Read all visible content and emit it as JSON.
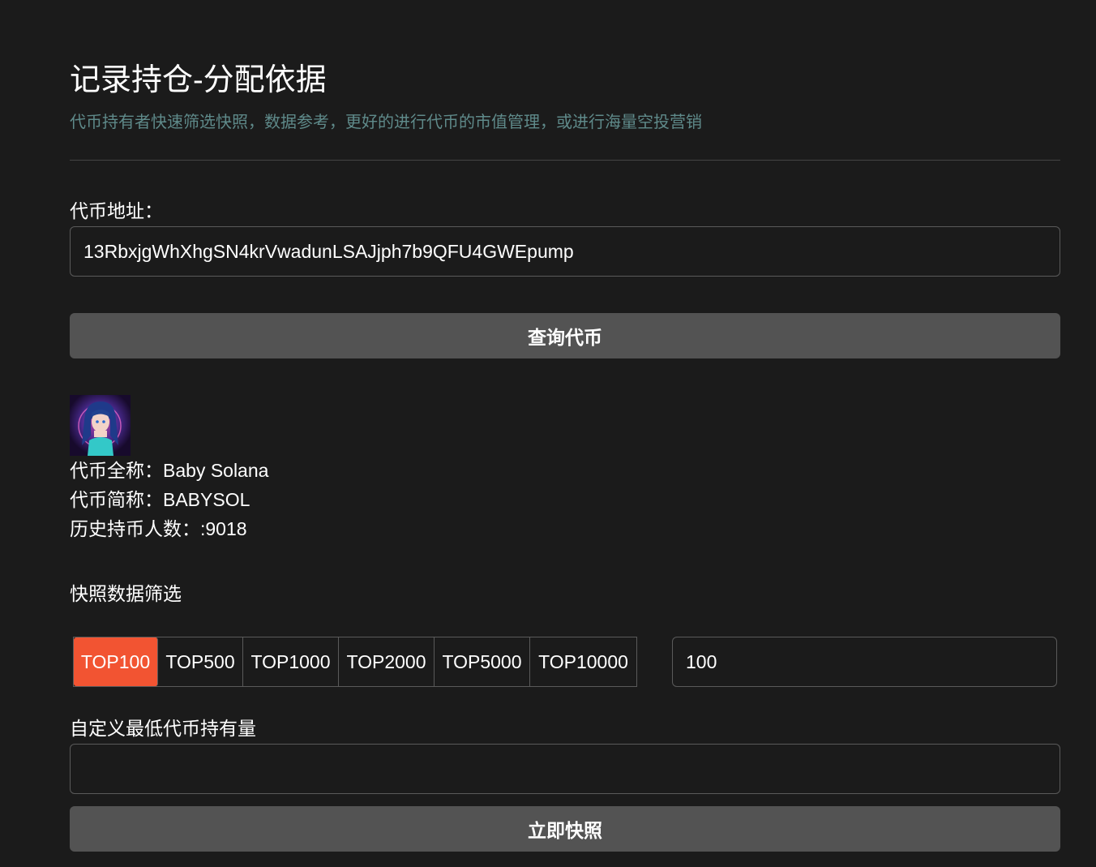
{
  "header": {
    "title": "记录持仓-分配依据",
    "subtitle": "代币持有者快速筛选快照，数据参考，更好的进行代币的市值管理，或进行海量空投营销"
  },
  "token_address": {
    "label": "代币地址：",
    "value": "13RbxjgWhXhgSN4krVwadunLSAJjph7b9QFU4GWEpump"
  },
  "query_button": {
    "label": "查询代币"
  },
  "token_info": {
    "full_name_label": "代币全称：",
    "full_name": "Baby Solana",
    "symbol_label": "代币简称：",
    "symbol": "BABYSOL",
    "holders_label": "历史持币人数：:",
    "holders": "9018"
  },
  "snapshot_filter": {
    "label": "快照数据筛选",
    "tabs": [
      {
        "label": "TOP100",
        "active": true
      },
      {
        "label": "TOP500",
        "active": false
      },
      {
        "label": "TOP1000",
        "active": false
      },
      {
        "label": "TOP2000",
        "active": false
      },
      {
        "label": "TOP5000",
        "active": false
      },
      {
        "label": "TOP10000",
        "active": false
      }
    ],
    "count_value": "100",
    "active_color": "#f25432"
  },
  "min_holding": {
    "label": "自定义最低代币持有量",
    "value": ""
  },
  "snapshot_button": {
    "label": "立即快照"
  }
}
